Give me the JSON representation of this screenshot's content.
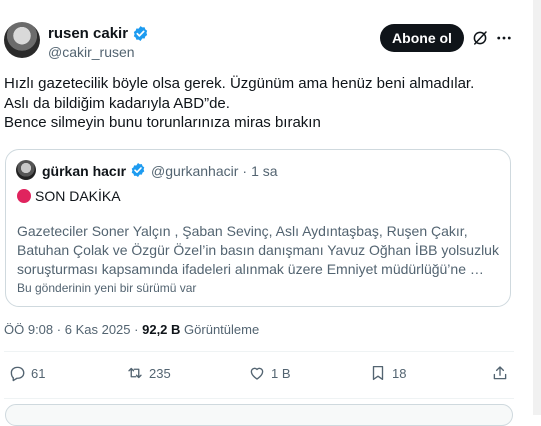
{
  "tweet": {
    "author_name": "rusen cakir",
    "author_handle": "@cakir_rusen",
    "follow_label": "Abone ol",
    "lines": [
      "Hızlı gazetecilik böyle olsa gerek. Üzgünüm ama henüz beni almadılar.",
      "Aslı da bildiğim kadarıyla ABD”de.",
      "Bence silmeyin bunu torunlarınıza miras bırakın"
    ]
  },
  "quote": {
    "author_name": "gürkan hacır",
    "author_handle": "@gurkanhacir",
    "separator": "·",
    "time": "1 sa",
    "flag_text": "SON DAKİKA",
    "body_lines": [
      "Gazeteciler Soner Yalçın , Şaban Sevinç, Aslı Aydıntaşbaş, Ruşen Çakır,",
      "Batuhan Çolak ve Özgür Özel’in basın danışmanı Yavuz Oğhan İBB yolsuzluk",
      "soruşturması kapsamında ifadeleri alınmak üzere Emniyet müdürlüğü’ne …"
    ],
    "note": "Bu gönderinin yeni bir sürümü var"
  },
  "stats": {
    "time": "ÖÖ 9:08",
    "separator": "·",
    "date": "6 Kas 2025",
    "views": "92,2 B",
    "views_label": "Görüntüleme"
  },
  "actions": {
    "replies": "61",
    "reposts": "235",
    "likes": "1 B",
    "bookmarks": "18"
  },
  "icons": [
    "verified-badge-icon",
    "grok-icon",
    "more-icon",
    "reply-icon",
    "repost-icon",
    "like-icon",
    "bookmark-icon",
    "share-icon"
  ],
  "colors": {
    "verified": "#1d9bf0",
    "text": "#0f1419",
    "muted": "#536471",
    "flag": "#e0245e"
  }
}
